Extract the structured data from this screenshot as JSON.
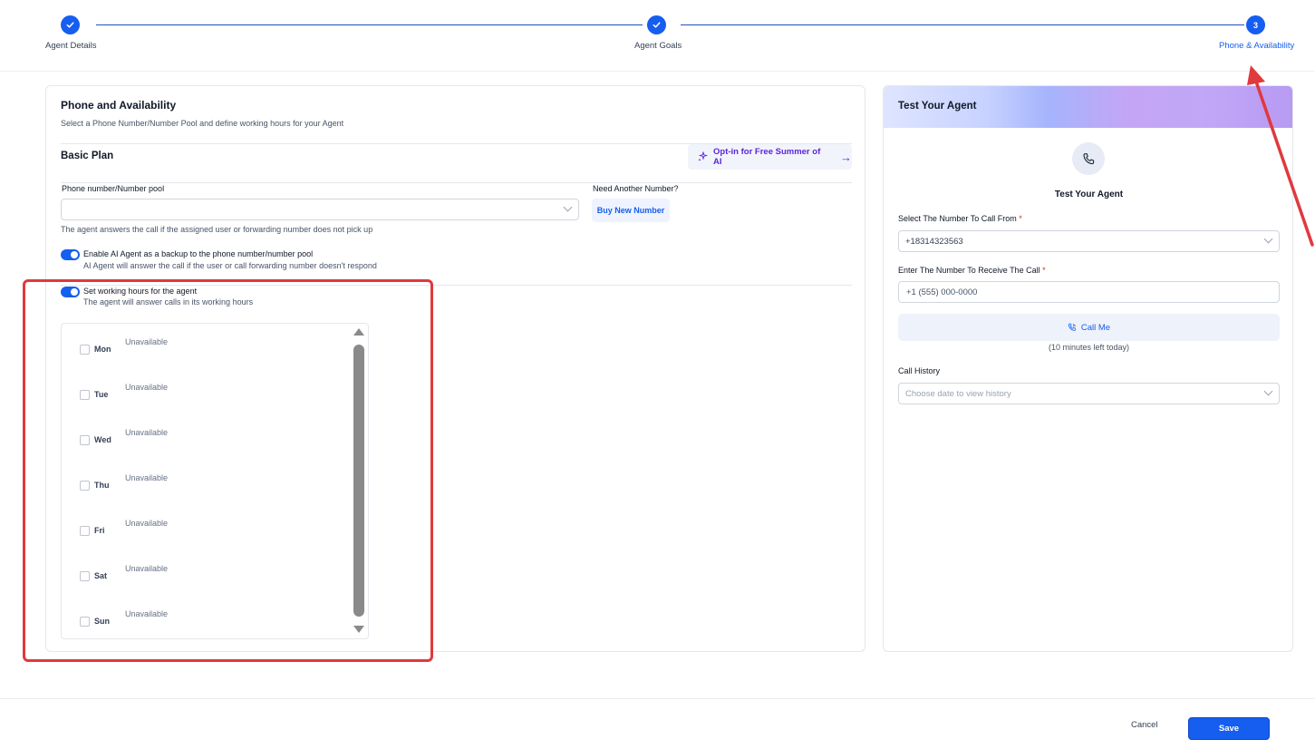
{
  "stepper": {
    "steps": [
      {
        "label": "Agent Details",
        "status": "complete"
      },
      {
        "label": "Agent Goals",
        "status": "complete"
      },
      {
        "label": "Phone & Availability",
        "status": "active",
        "number": "3"
      }
    ]
  },
  "phone_section": {
    "title": "Phone and Availability",
    "subtitle": "Select a Phone Number/Number Pool and define working hours for your Agent",
    "plan_label": "Basic Plan",
    "optin_label": "Opt-in for Free Summer of AI",
    "phone_pool_label": "Phone number/Number pool",
    "phone_pool_value": "",
    "need_number_label": "Need Another Number?",
    "buy_number_label": "Buy New Number",
    "answer_hint": "The agent answers the call if the assigned user or forwarding number does not pick up",
    "backup_toggle_label": "Enable AI Agent as a backup to the phone number/number pool",
    "backup_toggle_hint": "AI Agent will answer the call if the user or call forwarding number doesn't respond",
    "backup_toggle_on": true,
    "hours_toggle_label": "Set working hours for the agent",
    "hours_toggle_hint": "The agent will answer calls in its working hours",
    "hours_toggle_on": true,
    "days": [
      {
        "name": "Mon",
        "status": "Unavailable",
        "checked": false
      },
      {
        "name": "Tue",
        "status": "Unavailable",
        "checked": false
      },
      {
        "name": "Wed",
        "status": "Unavailable",
        "checked": false
      },
      {
        "name": "Thu",
        "status": "Unavailable",
        "checked": false
      },
      {
        "name": "Fri",
        "status": "Unavailable",
        "checked": false
      },
      {
        "name": "Sat",
        "status": "Unavailable",
        "checked": false
      },
      {
        "name": "Sun",
        "status": "Unavailable",
        "checked": false
      }
    ]
  },
  "test_panel": {
    "header_title": "Test Your Agent",
    "center_title": "Test Your Agent",
    "from_label": "Select The Number To Call From",
    "from_value": "+18314323563",
    "to_label": "Enter The Number To Receive The Call",
    "to_placeholder": "+1 (555) 000-0000",
    "required_mark": "*",
    "call_button_label": "Call Me",
    "minutes_left": "(10 minutes left today)",
    "history_label": "Call History",
    "history_placeholder": "Choose date to view history"
  },
  "footer": {
    "cancel_label": "Cancel",
    "save_label": "Save"
  },
  "colors": {
    "primary": "#155eef",
    "annotation": "#e0393e",
    "optin": "#5925dc"
  }
}
